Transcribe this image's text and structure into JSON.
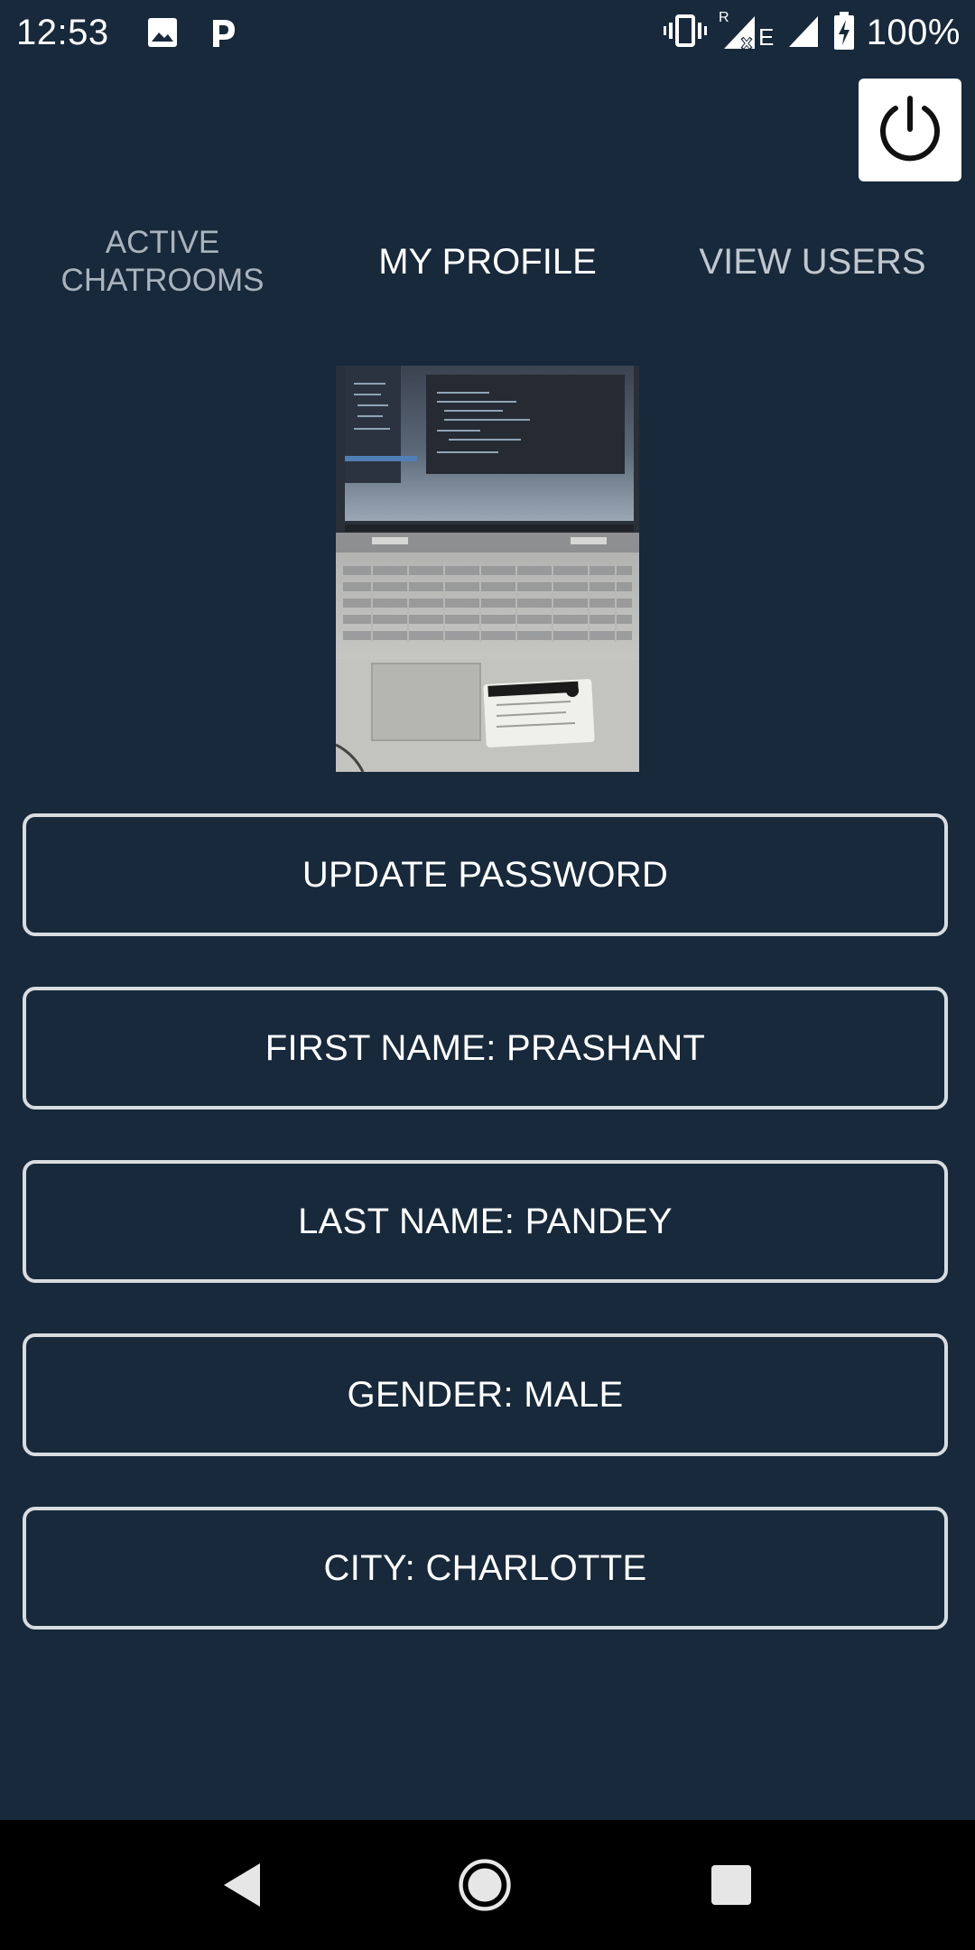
{
  "status_bar": {
    "time": "12:53",
    "battery_percent": "100%",
    "icons": [
      "image-icon",
      "p-app-icon",
      "vibrate-icon",
      "signal-roaming-icon",
      "signal-icon",
      "battery-charging-icon"
    ]
  },
  "tabs": [
    {
      "label": "ACTIVE\nCHATROOMS",
      "active": false
    },
    {
      "label": "MY PROFILE",
      "active": true
    },
    {
      "label": "VIEW USERS",
      "active": false
    }
  ],
  "profile": {
    "buttons": {
      "update_password": "UPDATE PASSWORD",
      "first_name": "FIRST NAME: PRASHANT",
      "last_name": "LAST NAME: PANDEY",
      "gender": "GENDER: MALE",
      "city": "CITY: CHARLOTTE"
    }
  },
  "colors": {
    "background": "#17293b",
    "button_border": "#d8dce0",
    "text_active": "#ffffff",
    "text_inactive": "#a9b3bd",
    "nav_bar": "#000000"
  }
}
